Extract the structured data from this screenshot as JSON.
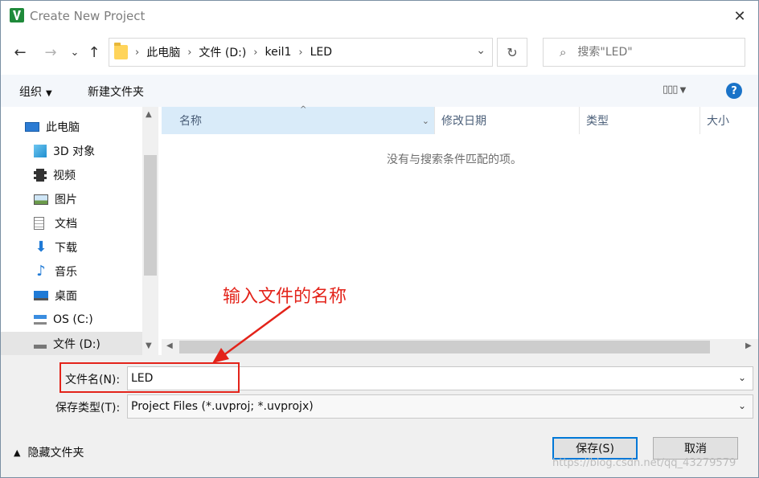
{
  "window": {
    "title": "Create New Project",
    "close_glyph": "✕"
  },
  "nav": {
    "back": "←",
    "forward": "→",
    "recent": "⌄",
    "up": "↑",
    "breadcrumb": [
      "此电脑",
      "文件 (D:)",
      "keil1",
      "LED"
    ],
    "refresh": "↻",
    "search_placeholder": "搜索\"LED\"",
    "search_icon": "⌕"
  },
  "toolbar": {
    "organize": "组织",
    "new_folder": "新建文件夹",
    "view_icon": "▯▯▯",
    "help": "?"
  },
  "sidebar": {
    "items": [
      {
        "label": "此电脑",
        "icon": "computer-icon"
      },
      {
        "label": "3D 对象",
        "icon": "cube-icon"
      },
      {
        "label": "视频",
        "icon": "film-icon"
      },
      {
        "label": "图片",
        "icon": "picture-icon"
      },
      {
        "label": "文档",
        "icon": "document-icon"
      },
      {
        "label": "下载",
        "icon": "download-icon"
      },
      {
        "label": "音乐",
        "icon": "music-icon"
      },
      {
        "label": "桌面",
        "icon": "desktop-icon"
      },
      {
        "label": "OS (C:)",
        "icon": "drive-icon"
      },
      {
        "label": "文件 (D:)",
        "icon": "drive-icon",
        "selected": true
      }
    ]
  },
  "filelist": {
    "columns": [
      "名称",
      "修改日期",
      "类型",
      "大小"
    ],
    "empty_message": "没有与搜索条件匹配的项。"
  },
  "form": {
    "filename_label": "文件名(N):",
    "filename_value": "LED",
    "filetype_label": "保存类型(T):",
    "filetype_value": "Project Files (*.uvproj; *.uvprojx)",
    "hide_folders": "隐藏文件夹",
    "save_button": "保存(S)",
    "cancel_button": "取消"
  },
  "annotation": {
    "text": "输入文件的名称",
    "color": "#e3231a"
  },
  "watermark": "https://blog.csdn.net/qq_43279579"
}
